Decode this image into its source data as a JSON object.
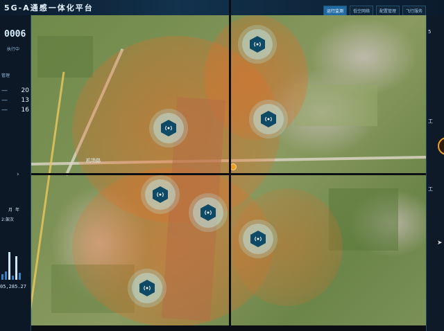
{
  "header": {
    "title": "5G-A通感一体化平台",
    "tabs": [
      "运行监测",
      "低空网络",
      "配置管理",
      "飞行服务"
    ],
    "active_tab": 0
  },
  "left_panel": {
    "counter": "0006",
    "counter_sub": "执行中",
    "section_label": "管理",
    "stats": [
      "20",
      "13",
      "16"
    ],
    "tabs": [
      "月",
      "年"
    ],
    "info_line": "2:架次",
    "value": "05,285.27"
  },
  "right_panel": {
    "items": [
      "5",
      "工",
      "工"
    ]
  },
  "map": {
    "labels": [
      "机场路"
    ],
    "towers": [
      "tower-1",
      "tower-2",
      "tower-3",
      "tower-4",
      "tower-5",
      "tower-6",
      "tower-7",
      "tower-8"
    ]
  },
  "colors": {
    "coverage": "#e86c26",
    "tower": "#0e4a66",
    "accent": "#1f6aa3"
  }
}
